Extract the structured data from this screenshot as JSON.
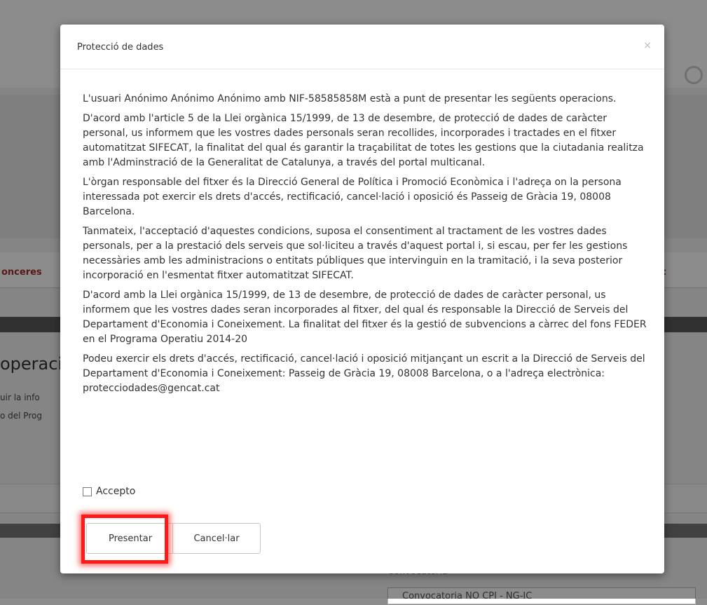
{
  "background": {
    "tab_left": "onceres",
    "tab_right": "c",
    "heading": "operaci",
    "line1": "uir la info",
    "line2": "o del Prog",
    "bottom_label": "Convocatòria",
    "bottom_select": "Convocatoria NO CPI - NG-IC"
  },
  "modal": {
    "title": "Protecció de dades",
    "close_symbol": "×",
    "paragraphs": [
      "L'usuari Anónimo Anónimo Anónimo amb NIF-58585858M està a punt de presentar les següents operacions.",
      "D'acord amb l'article 5 de la Llei orgànica 15/1999, de 13 de desembre, de protecció de dades de caràcter personal, us informem que les vostres dades personals seran recollides, incorporades i tractades en el fitxer automatitzat SIFECAT, la finalitat del qual és garantir la traçabilitat de totes les gestions que la ciutadania realitza amb l'Adminstració de la Generalitat de Catalunya, a través del portal multicanal.",
      "L'òrgan responsable del fitxer és la Direcció General de Política i Promoció Econòmica i l'adreça on la persona interessada pot exercir els drets d'accés, rectificació, cancel·lació i oposició és Passeig de Gràcia 19, 08008 Barcelona.",
      "Tanmateix, l'acceptació d'aquestes condicions, suposa el consentiment al tractament de les vostres dades personals, per a la prestació dels serveis que sol·liciteu a través d'aquest portal i, si escau, per fer les gestions necessàries amb les administracions o entitats públiques que intervinguin en la tramitació, i la seva posterior incorporació en l'esmentat fitxer automatitzat SIFECAT.",
      "D'acord amb la Llei orgànica 15/1999, de 13 de desembre, de protecció de dades de caràcter personal, us informem que les vostres dades seran incorporades al fitxer, del qual és responsable la Direcció de Serveis del Departament d'Economia i Coneixement. La finalitat del fitxer és la gestió de subvencions a càrrec del fons FEDER en el Programa Operatiu 2014-20",
      "Podeu exercir els drets d'accés, rectificació, cancel·lació i oposició mitjançant un escrit a la Direcció de Serveis del Departament d'Economia i Coneixement: Passeig de Gràcia 19, 08008 Barcelona, o a l'adreça electrònica: protecciodades@gencat.cat"
    ],
    "accept_label": "Accepto",
    "accept_checked": false,
    "present_label": "Presentar",
    "cancel_label": "Cancel·lar"
  },
  "colors": {
    "highlight": "#ff1a1a",
    "tab_accent": "#a0302a"
  }
}
